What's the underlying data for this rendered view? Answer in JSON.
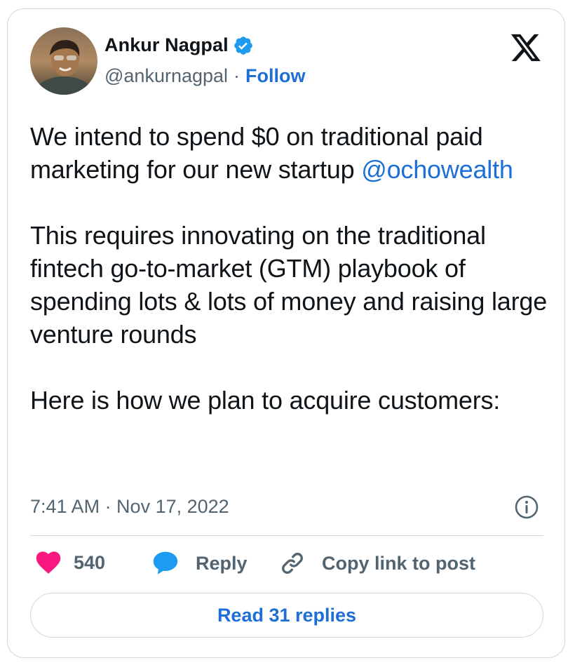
{
  "author": {
    "name": "Ankur Nagpal",
    "handle": "@ankurnagpal",
    "separator": "·",
    "follow_label": "Follow",
    "verified": true
  },
  "tweet": {
    "line1_before_mention": "We intend to spend $0 on traditional paid marketing for our new startup",
    "mention": "@ochowealth",
    "paragraph2": "This requires innovating on the traditional fintech go-to-market (GTM) playbook of spending lots & lots of money and raising large venture rounds",
    "paragraph3": "Here is how we plan to acquire customers:"
  },
  "meta": {
    "timestamp": "7:41 AM · Nov 17, 2022"
  },
  "actions": {
    "like_count": "540",
    "reply_label": "Reply",
    "copy_label": "Copy link to post"
  },
  "footer": {
    "read_replies_label": "Read 31 replies"
  },
  "colors": {
    "accent": "#1d6fd6",
    "like": "#f91880",
    "reply": "#1d9bf0",
    "muted": "#536471",
    "border": "#cfd9de"
  },
  "icons": [
    "verified-badge-icon",
    "x-logo-icon",
    "info-icon",
    "heart-icon",
    "speech-bubble-icon",
    "link-icon"
  ]
}
